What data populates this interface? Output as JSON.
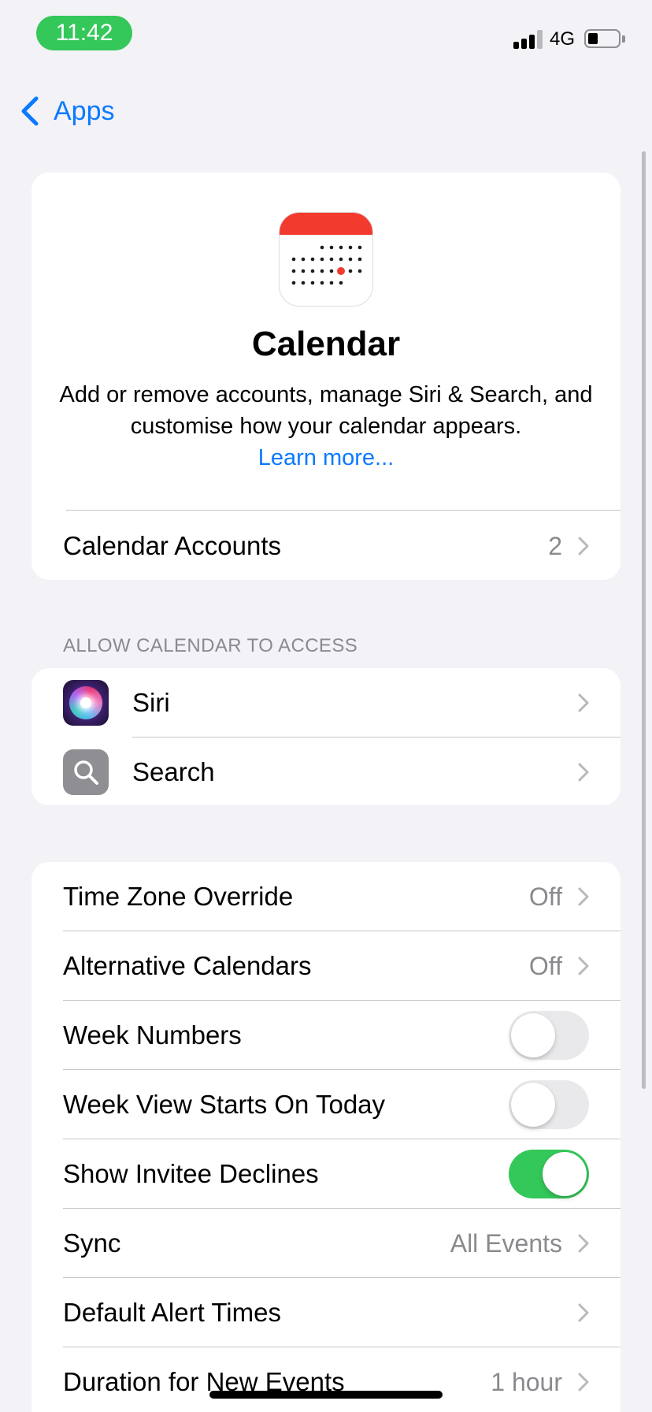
{
  "status_bar": {
    "time": "11:42",
    "network": "4G"
  },
  "nav": {
    "back_label": "Apps"
  },
  "hero": {
    "title": "Calendar",
    "description": "Add or remove accounts, manage Siri & Search, and customise how your calendar appears.",
    "learn_more": "Learn more...",
    "accounts_row": {
      "label": "Calendar Accounts",
      "value": "2"
    }
  },
  "access": {
    "header": "ALLOW CALENDAR TO ACCESS",
    "items": [
      {
        "label": "Siri",
        "icon": "siri-icon"
      },
      {
        "label": "Search",
        "icon": "magnifier-icon"
      }
    ]
  },
  "settings": {
    "rows": [
      {
        "label": "Time Zone Override",
        "value": "Off",
        "type": "disclosure"
      },
      {
        "label": "Alternative Calendars",
        "value": "Off",
        "type": "disclosure"
      },
      {
        "label": "Week Numbers",
        "type": "toggle",
        "on": false
      },
      {
        "label": "Week View Starts On Today",
        "type": "toggle",
        "on": false
      },
      {
        "label": "Show Invitee Declines",
        "type": "toggle",
        "on": true
      },
      {
        "label": "Sync",
        "value": "All Events",
        "type": "disclosure"
      },
      {
        "label": "Default Alert Times",
        "value": "",
        "type": "disclosure"
      },
      {
        "label": "Duration for New Events",
        "value": "1 hour",
        "type": "disclosure"
      }
    ]
  },
  "colors": {
    "accent": "#0a7aff",
    "toggle_on": "#34c759",
    "calendar_red": "#f23a2f",
    "background": "#f2f2f7"
  }
}
